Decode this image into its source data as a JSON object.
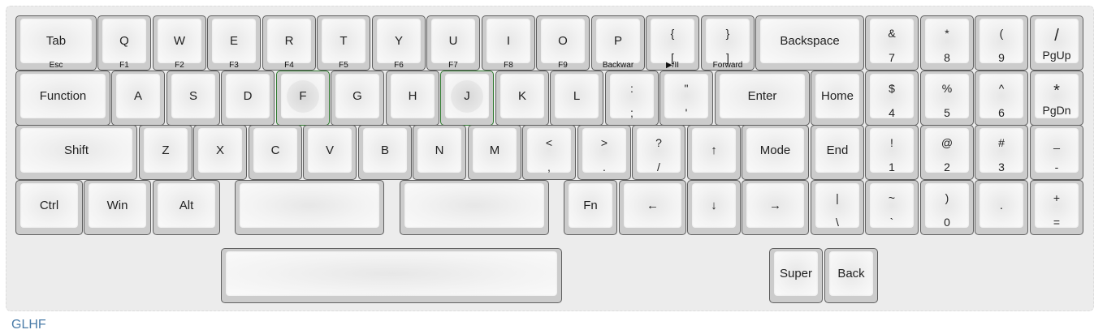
{
  "keyboard": {
    "rows": [
      [
        {
          "main": "Tab",
          "front": "Esc"
        },
        {
          "main": "Q",
          "front": "F1"
        },
        {
          "main": "W",
          "front": "F2"
        },
        {
          "main": "E",
          "front": "F3"
        },
        {
          "main": "R",
          "front": "F4"
        },
        {
          "main": "T",
          "front": "F5"
        },
        {
          "main": "Y",
          "front": "F6"
        },
        {
          "main": "U",
          "front": "F7"
        },
        {
          "main": "I",
          "front": "F8"
        },
        {
          "main": "O",
          "front": "F9"
        },
        {
          "main": "P",
          "front": "Backwar"
        },
        {
          "top": "{",
          "bottom": "[",
          "front": "▶/II"
        },
        {
          "top": "}",
          "bottom": "]",
          "front": "Forward"
        },
        {
          "main": "Backspace"
        },
        {
          "top": "&",
          "bottom": "7"
        },
        {
          "top": "*",
          "bottom": "8"
        },
        {
          "top": "(",
          "bottom": "9"
        },
        {
          "top": "/",
          "bottom": "PgUp"
        }
      ],
      [
        {
          "main": "Function"
        },
        {
          "main": "A"
        },
        {
          "main": "S"
        },
        {
          "main": "D"
        },
        {
          "main": "F"
        },
        {
          "main": "G"
        },
        {
          "main": "H"
        },
        {
          "main": "J"
        },
        {
          "main": "K"
        },
        {
          "main": "L"
        },
        {
          "top": ":",
          "bottom": ";"
        },
        {
          "top": "\"",
          "bottom": "'"
        },
        {
          "main": "Enter"
        },
        {
          "main": "Home"
        },
        {
          "top": "$",
          "bottom": "4"
        },
        {
          "top": "%",
          "bottom": "5"
        },
        {
          "top": "^",
          "bottom": "6"
        },
        {
          "top": "*",
          "bottom": "PgDn"
        }
      ],
      [
        {
          "main": "Shift"
        },
        {
          "main": "Z"
        },
        {
          "main": "X"
        },
        {
          "main": "C"
        },
        {
          "main": "V"
        },
        {
          "main": "B"
        },
        {
          "main": "N"
        },
        {
          "main": "M"
        },
        {
          "top": "<",
          "bottom": ","
        },
        {
          "top": ">",
          "bottom": "."
        },
        {
          "top": "?",
          "bottom": "/"
        },
        {
          "main": "↑"
        },
        {
          "main": "Mode"
        },
        {
          "main": "End"
        },
        {
          "top": "!",
          "bottom": "1"
        },
        {
          "top": "@",
          "bottom": "2"
        },
        {
          "top": "#",
          "bottom": "3"
        },
        {
          "top": "_",
          "bottom": "-"
        }
      ],
      [
        {
          "main": "Ctrl"
        },
        {
          "main": "Win"
        },
        {
          "main": "Alt"
        },
        {
          "main": ""
        },
        {
          "main": ""
        },
        {
          "main": "Fn"
        },
        {
          "main": "←"
        },
        {
          "main": "↓"
        },
        {
          "main": "→"
        },
        {
          "top": "|",
          "bottom": "\\"
        },
        {
          "top": "~",
          "bottom": "`"
        },
        {
          "top": ")",
          "bottom": "0"
        },
        {
          "main": "."
        },
        {
          "top": "+",
          "bottom": "="
        }
      ],
      [
        {
          "main": ""
        },
        {
          "main": "Super"
        },
        {
          "main": "Back"
        }
      ]
    ]
  },
  "footer": {
    "label": "GLHF"
  },
  "colors": {
    "keycap_face": "#f5f5f5",
    "key_border": "#5f5f5f",
    "homing_border": "#2f7a2f",
    "link": "#4a7ca8"
  }
}
